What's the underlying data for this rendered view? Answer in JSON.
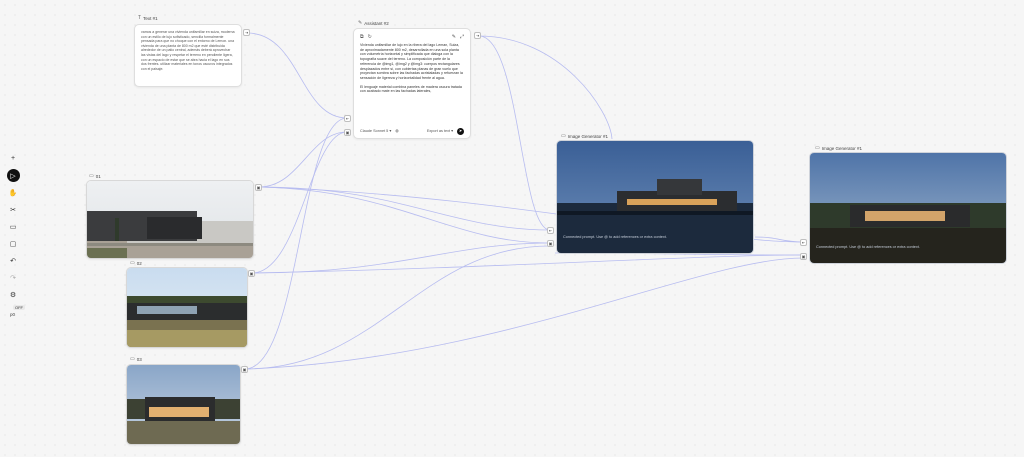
{
  "text_node": {
    "label": "Text #1",
    "body": "vamos a generar una vivienda unifamiliar en suiza, moderna con un estilo de lujo sofisticado, sencilla formalmente pensada para que no choque con el entorno de Lemon. una vivienda de una planta de 800 m2 que esté distribuida alrededor de un patio central, además deberá aprovechar las vistas del lago y respetar el terreno en pendiente ligera, con un espacio de estar que se abra hacia el lago en sus dos frentes. utilizar materiales en tonos oscuros integrados con el paisaje."
  },
  "assistant_node": {
    "label": "Assistant #2",
    "para1": "Vivienda unifamiliar de lujo en la ribera del lago Leman, Suiza, de aproximadamente 800 m2, desarrollada en una sola planta con volumetría horizontal y simplificada que dialoga con la topografía suave del terreno. La composición parte de la referencia de @img1, @img2 y @img3: cuerpos rectangulares desplazados entre sí, con cubiertas planas de gran vuelo que proyectan sombra sobre las fachadas acristaladas y refuerzan la sensación de ligereza y horizontalidad frente al agua.",
    "para2": "El lenguaje material combina paneles de madera oscura tratada con acabado mate en las fachadas laterales,",
    "model": "Claude Sonnet 5",
    "export": "Export as text"
  },
  "image_nodes": [
    {
      "label": "01"
    },
    {
      "label": "02"
    },
    {
      "label": "03"
    }
  ],
  "generator_nodes": [
    {
      "label": "Image Generator #1",
      "hint": "Connected prompt. Use @ to add references or extra context."
    },
    {
      "label": "Image Generator #1",
      "hint": "Connected prompt. Use @ to add references or extra context."
    }
  ],
  "toolbar": {
    "items": [
      "plus-icon",
      "pointer-icon",
      "hand-icon",
      "cut-icon",
      "frame-icon",
      "comment-icon",
      "undo-icon",
      "redo-icon",
      "settings-icon"
    ],
    "off_label": "OFF",
    "zoom": "p0"
  },
  "colors": {
    "wire": "#b9bdf0",
    "accent": "#111111"
  }
}
